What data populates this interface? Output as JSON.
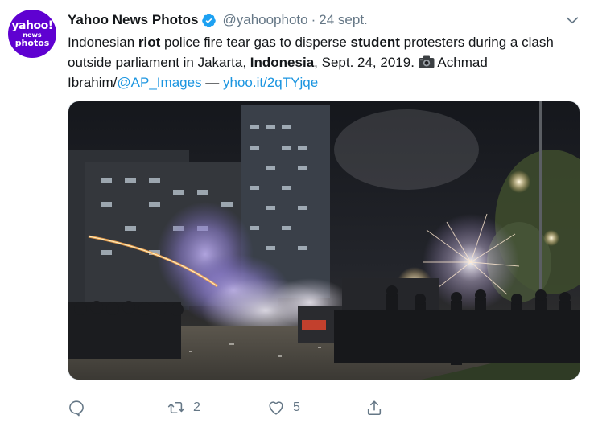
{
  "account": {
    "avatar_lines": [
      "yahoo!",
      "news",
      "photos"
    ],
    "name": "Yahoo News Photos",
    "handle": "@yahoophoto",
    "separator": "·",
    "date": "24 sept."
  },
  "tweet": {
    "segments": [
      {
        "text": "Indonesian ",
        "style": "normal"
      },
      {
        "text": "riot",
        "style": "bold"
      },
      {
        "text": " police fire tear gas to disperse ",
        "style": "normal"
      },
      {
        "text": "student",
        "style": "bold"
      },
      {
        "text": " protesters during a clash outside parliament in Jakarta, ",
        "style": "normal"
      },
      {
        "text": "Indonesia",
        "style": "bold"
      },
      {
        "text": ", Sept. 24, 2019. ",
        "style": "normal"
      },
      {
        "text": " Achmad Ibrahim/",
        "style": "normal"
      },
      {
        "text": "@AP_Images",
        "style": "link"
      },
      {
        "text": " — ",
        "style": "normal"
      },
      {
        "text": "yhoo.it/2qTYjqe",
        "style": "link"
      }
    ]
  },
  "media": {
    "icon": "photo-image"
  },
  "actions": {
    "reply": {
      "icon": "reply-icon",
      "count": ""
    },
    "retweet": {
      "icon": "retweet-icon",
      "count": "2"
    },
    "like": {
      "icon": "heart-icon",
      "count": "5"
    },
    "share": {
      "icon": "share-icon",
      "count": ""
    }
  },
  "colors": {
    "text": "#14171a",
    "muted": "#657786",
    "link": "#1b95e0",
    "verified": "#1da1f2",
    "avatar_bg": "#5f01d1"
  }
}
